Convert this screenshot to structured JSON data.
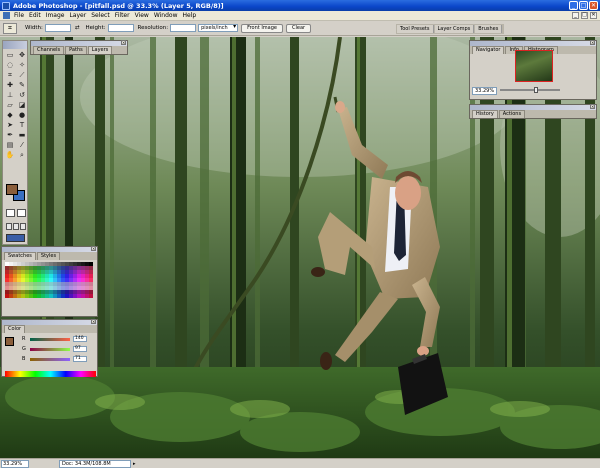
{
  "window": {
    "title": "Adobe Photoshop - [pitfall.psd @ 33.3% (Layer 5, RGB/8)]",
    "controls": [
      "_",
      "□",
      "✕"
    ]
  },
  "menu": {
    "items": [
      "File",
      "Edit",
      "Image",
      "Layer",
      "Select",
      "Filter",
      "View",
      "Window",
      "Help"
    ]
  },
  "options": {
    "width_label": "Width:",
    "height_label": "Height:",
    "resolution_label": "Resolution:",
    "resolution_unit": "pixels/inch",
    "front_image_label": "Front Image",
    "clear_label": "Clear",
    "swap_icon": "⇄"
  },
  "palette_well": {
    "tabs": [
      "Tool Presets",
      "Layer Comps",
      "Brushes"
    ]
  },
  "layers_palette": {
    "tabs": [
      "Channels",
      "Paths",
      "Layers"
    ]
  },
  "swatches_palette": {
    "tabs": [
      "Swatches",
      "Styles"
    ]
  },
  "color_palette": {
    "tab": "Color",
    "channels": [
      {
        "label": "R",
        "value": "140",
        "level": 0.55
      },
      {
        "label": "G",
        "value": "97",
        "level": 0.38
      },
      {
        "label": "B",
        "value": "71",
        "level": 0.28
      }
    ]
  },
  "navigator_palette": {
    "tabs": [
      "Navigator",
      "Info",
      "Histogram"
    ],
    "zoom": "33.29%",
    "zoom_level": 0.6
  },
  "history_palette": {
    "tabs": [
      "History",
      "Actions"
    ]
  },
  "status": {
    "zoom": "33.29%",
    "doc_info": "Doc: 34.3M/108.8M"
  },
  "colors": {
    "foreground": "#8a5e3b",
    "background": "#3a6fc0",
    "title_bar": "#0a46c9"
  }
}
